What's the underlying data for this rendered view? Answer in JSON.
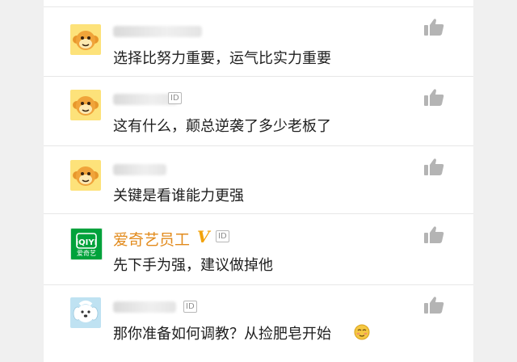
{
  "comments": [
    {
      "text": "选择比努力重要，运气比实力重要",
      "avatar": "monkey-avatar"
    },
    {
      "text": "这有什么，颠总逆袭了多少老板了",
      "avatar": "monkey-avatar",
      "id_badge": "ID"
    },
    {
      "text": "关键是看谁能力更强",
      "avatar": "monkey-avatar"
    },
    {
      "text": "先下手为强，建议做掉他",
      "avatar": "iqiyi-avatar",
      "username": "爱奇艺员工",
      "verified": "V",
      "id_badge": "ID",
      "avatar_label": "爱奇艺"
    },
    {
      "text": "那你准备如何调教？从捡肥皂开始",
      "avatar": "dog-avatar",
      "id_badge": "ID",
      "emoji": "shy-face-emoji"
    }
  ],
  "icons": {
    "like": "thumbs-up-icon"
  },
  "colors": {
    "username": "#e28b1d",
    "verified": "#f2a20a",
    "iqiyi_green": "#00a23b",
    "monkey": "#f5a623",
    "like_icon": "#b4b4b4"
  }
}
